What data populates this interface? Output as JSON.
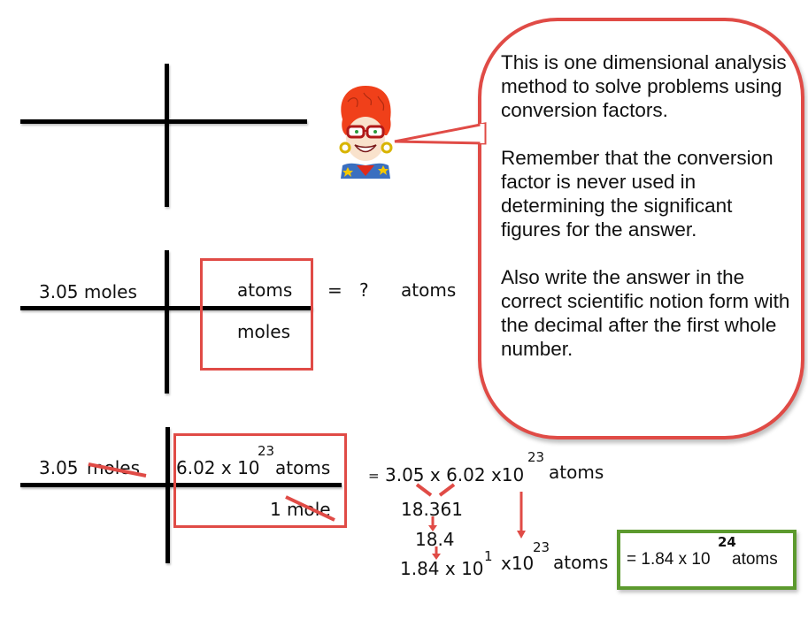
{
  "speech_bubble": {
    "paragraphs": [
      "This is one dimensional analysis method to solve problems using conversion factors.",
      "Remember that the conversion factor is never used in determining the significant figures for the answer.",
      "Also write the answer in the correct scientific notion form with the decimal after the first whole number."
    ]
  },
  "teacher_icon": "teacher-cartoon-icon",
  "setup": {
    "given": "3.05 moles",
    "numerator_unit": "atoms",
    "denominator_unit": "moles",
    "equals": "=",
    "unknown": "?",
    "result_unit": "atoms"
  },
  "solved": {
    "given_number": "3.05",
    "given_unit": "moles",
    "factor_numerator": "6.02 x 10",
    "factor_numerator_exp": "23",
    "factor_numerator_unit": "atoms",
    "factor_denominator_number": "1",
    "factor_denominator_unit": "mole"
  },
  "work": {
    "equals_small": "=",
    "expression": "3.05 x 6.02 x10",
    "expression_exp": "23",
    "expression_unit": "atoms",
    "product": "18.361",
    "rounded": "18.4",
    "sci_mantissa": "1.84 x 10",
    "sci_exp": "1",
    "times_power": "x10",
    "times_power_exp": "23",
    "final_unit": "atoms"
  },
  "answer": {
    "prefix": "= 1.84 x 10",
    "exp": "24",
    "unit": "atoms"
  },
  "colors": {
    "red": "#e04b46",
    "green": "#5c9a2e",
    "black": "#000000"
  }
}
